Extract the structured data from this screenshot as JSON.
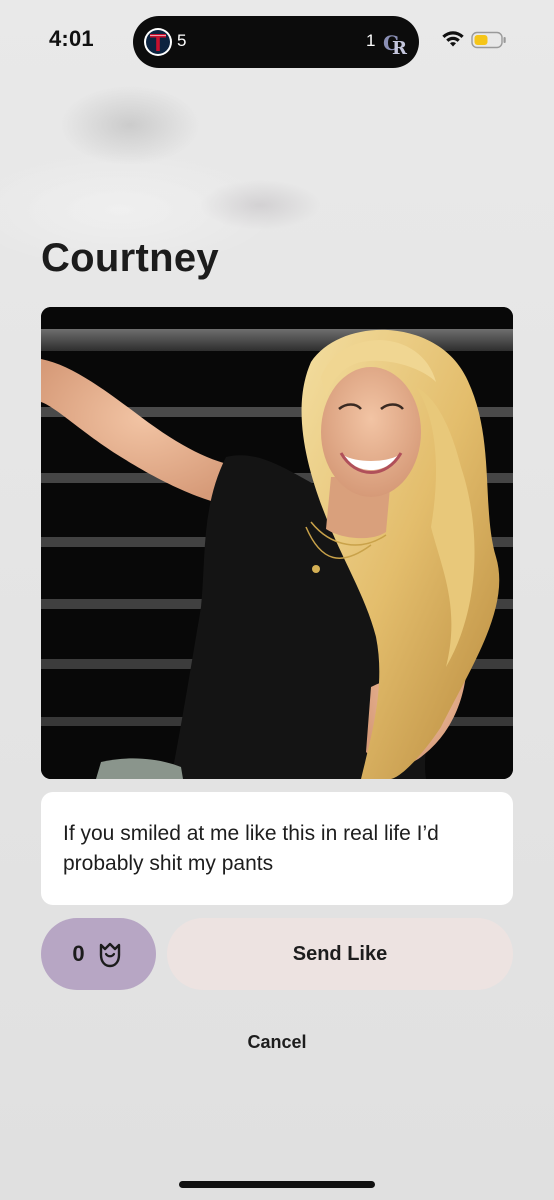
{
  "status_bar": {
    "time": "4:01",
    "live_activity": {
      "home_score": "5",
      "away_score": "1",
      "home_team_icon": "twins-logo-icon",
      "away_team_icon": "rockies-logo-icon"
    },
    "wifi_icon": "wifi-icon",
    "battery_icon": "battery-icon",
    "battery_color": "#f5c518"
  },
  "profile": {
    "name": "Courtney",
    "photo_icon": "profile-photo"
  },
  "comment": {
    "text": "If you smiled at me like this in real life I’d probably shit my pants"
  },
  "actions": {
    "rose_count": "0",
    "rose_icon": "rose-icon",
    "rose_button_color": "#b7a6c4",
    "send_like_label": "Send Like",
    "send_like_color": "#ede3e1",
    "cancel_label": "Cancel"
  }
}
